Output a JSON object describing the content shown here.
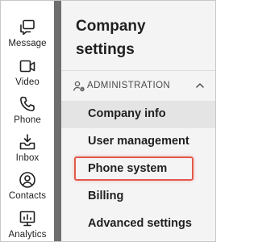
{
  "rail": {
    "items": [
      {
        "label": "Message",
        "icon": "message-icon"
      },
      {
        "label": "Video",
        "icon": "video-icon"
      },
      {
        "label": "Phone",
        "icon": "phone-icon"
      },
      {
        "label": "Inbox",
        "icon": "inbox-icon"
      },
      {
        "label": "Contacts",
        "icon": "contacts-icon"
      },
      {
        "label": "Analytics",
        "icon": "analytics-icon"
      }
    ]
  },
  "panel": {
    "title": "Company settings",
    "section": {
      "label": "ADMINISTRATION",
      "icon": "admin-user-gear-icon",
      "toggle_icon": "chevron-up-icon"
    },
    "items": [
      {
        "label": "Company info",
        "active": true
      },
      {
        "label": "User management",
        "active": false
      },
      {
        "label": "Phone system",
        "active": false,
        "highlighted": true
      },
      {
        "label": "Billing",
        "active": false
      },
      {
        "label": "Advanced settings",
        "active": false
      }
    ]
  },
  "colors": {
    "highlight": "#e2584b",
    "panel_bg": "#f4f4f4",
    "active_item_bg": "#e4e4e4",
    "scrollbar": "#6e6e6e"
  }
}
